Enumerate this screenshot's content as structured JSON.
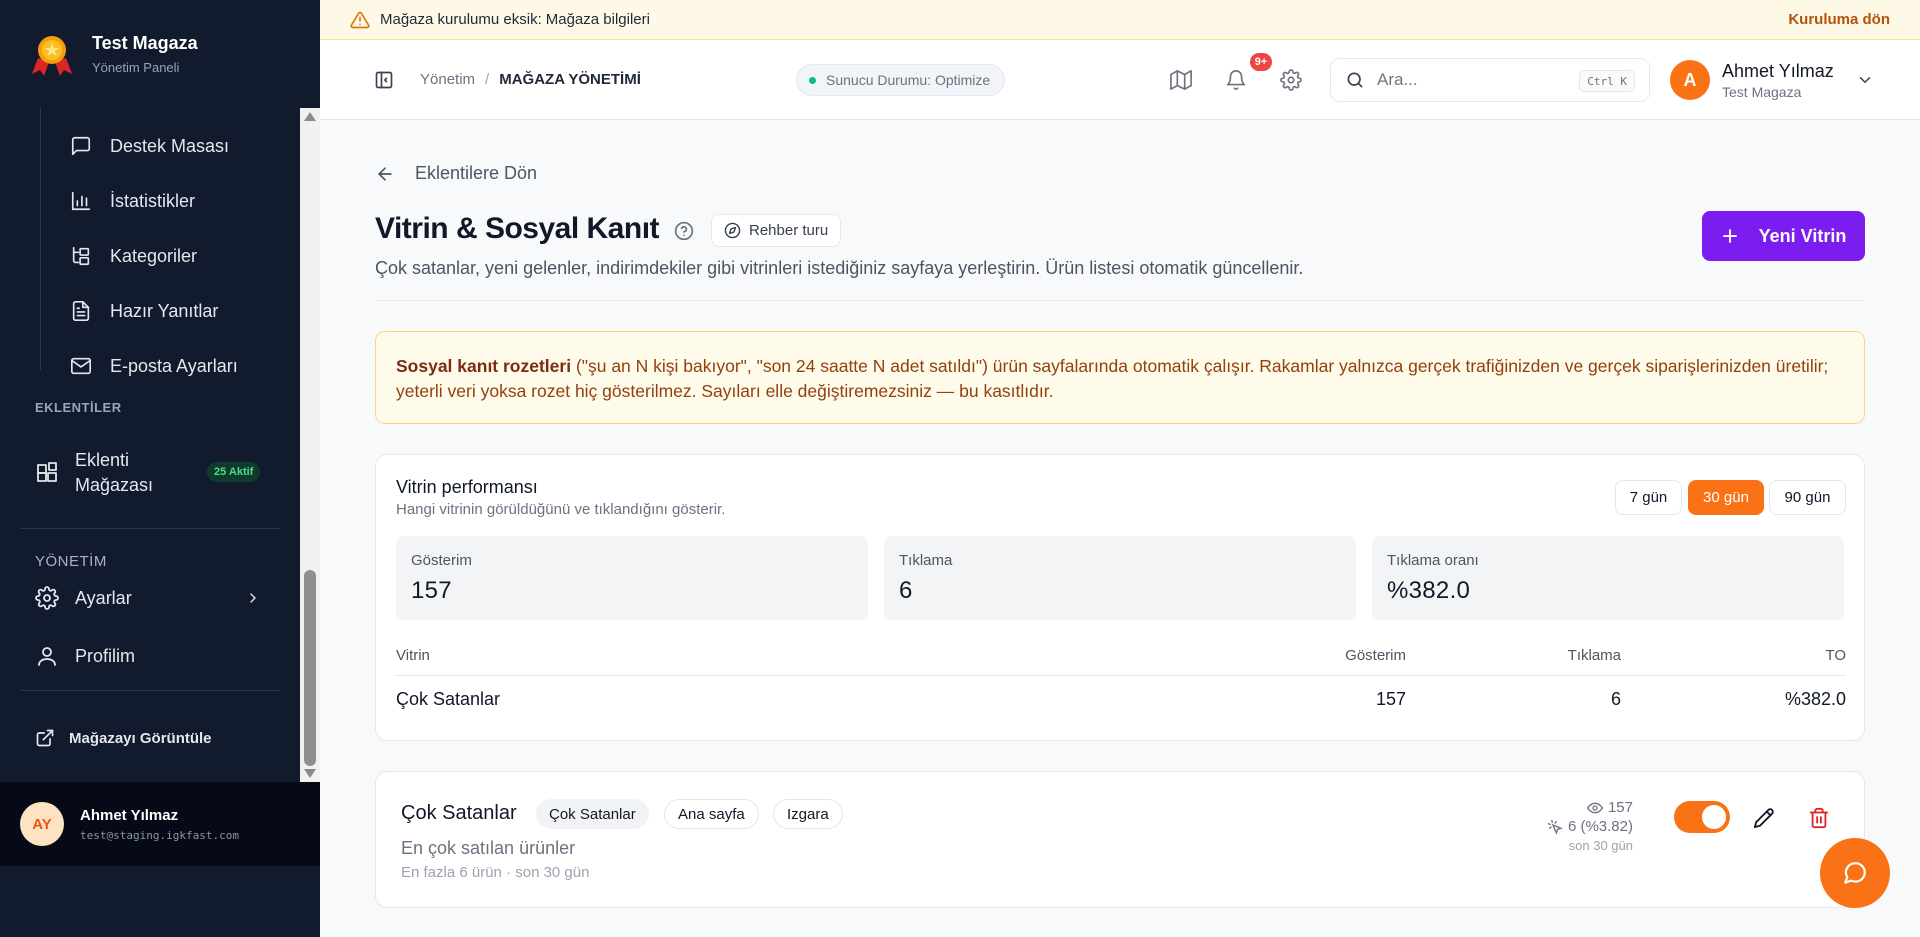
{
  "brand": {
    "name": "Test Magaza",
    "subtitle": "Yönetim Paneli"
  },
  "sidebar": {
    "sub_items": [
      {
        "label": "Destek Masası",
        "icon": "message-square-icon"
      },
      {
        "label": "İstatistikler",
        "icon": "bar-chart-icon"
      },
      {
        "label": "Kategoriler",
        "icon": "folder-tree-icon"
      },
      {
        "label": "Hazır Yanıtlar",
        "icon": "file-text-icon"
      },
      {
        "label": "E-posta Ayarları",
        "icon": "mail-icon"
      }
    ],
    "section_extensions": "EKLENTİLER",
    "extension_store": {
      "label_line1": "Eklenti",
      "label_line2": "Mağazası",
      "badge": "25 Aktif"
    },
    "section_admin": "YÖNETİM",
    "settings_label": "Ayarlar",
    "profile_label": "Profilim",
    "view_store_label": "Mağazayı Görüntüle",
    "user": {
      "initials": "AY",
      "name": "Ahmet Yılmaz",
      "email": "test@staging.igkfast.com"
    }
  },
  "banner": {
    "text": "Mağaza kurulumu eksik:",
    "link_inline": "Mağaza bilgileri",
    "action": "Kuruluma dön"
  },
  "header": {
    "breadcrumb_root": "Yönetim",
    "breadcrumb_sep": "/",
    "breadcrumb_current": "MAĞAZA YÖNETİMİ",
    "server_status": "Sunucu Durumu: Optimize",
    "notif_count": "9+",
    "search_placeholder": "Ara...",
    "search_shortcut": "Ctrl K",
    "user": {
      "initial": "A",
      "name": "Ahmet Yılmaz",
      "store": "Test Magaza"
    }
  },
  "page": {
    "back_label": "Eklentilere Dön",
    "title": "Vitrin & Sosyal Kanıt",
    "tour_label": "Rehber turu",
    "description": "Çok satanlar, yeni gelenler, indirimdekiler gibi vitrinleri istediğiniz sayfaya yerleştirin. Ürün listesi otomatik güncellenir.",
    "new_button": "Yeni Vitrin"
  },
  "notice": {
    "bold": "Sosyal kanıt rozetleri",
    "text": " (\"şu an N kişi bakıyor\", \"son 24 saatte N adet satıldı\") ürün sayfalarında otomatik çalışır. Rakamlar yalnızca gerçek trafiğinizden ve gerçek siparişlerinizden üretilir; yeterli veri yoksa rozet hiç gösterilmez. Sayıları elle değiştiremezsiniz — bu kasıtlıdır."
  },
  "performance": {
    "title": "Vitrin performansı",
    "subtitle": "Hangi vitrinin görüldüğünü ve tıklandığını gösterir.",
    "ranges": [
      "7 gün",
      "30 gün",
      "90 gün"
    ],
    "active_range": "30 gün",
    "stats": [
      {
        "label": "Gösterim",
        "value": "157"
      },
      {
        "label": "Tıklama",
        "value": "6"
      },
      {
        "label": "Tıklama oranı",
        "value": "%382.0"
      }
    ],
    "table": {
      "headers": [
        "Vitrin",
        "Gösterim",
        "Tıklama",
        "TO"
      ],
      "rows": [
        [
          "Çok Satanlar",
          "157",
          "6",
          "%382.0"
        ]
      ]
    }
  },
  "showcase": {
    "title": "Çok Satanlar",
    "chips": [
      "Çok Satanlar",
      "Ana sayfa",
      "Izgara"
    ],
    "description": "En çok satılan ürünler",
    "meta": "En fazla 6 ürün · son 30 gün",
    "views": "157",
    "clicks": "6 (%3.82)",
    "period": "son 30 gün",
    "enabled": true
  },
  "colors": {
    "accent_orange": "#f97316",
    "primary_purple": "#7c1df0",
    "sidebar_bg": "#121a2e"
  }
}
